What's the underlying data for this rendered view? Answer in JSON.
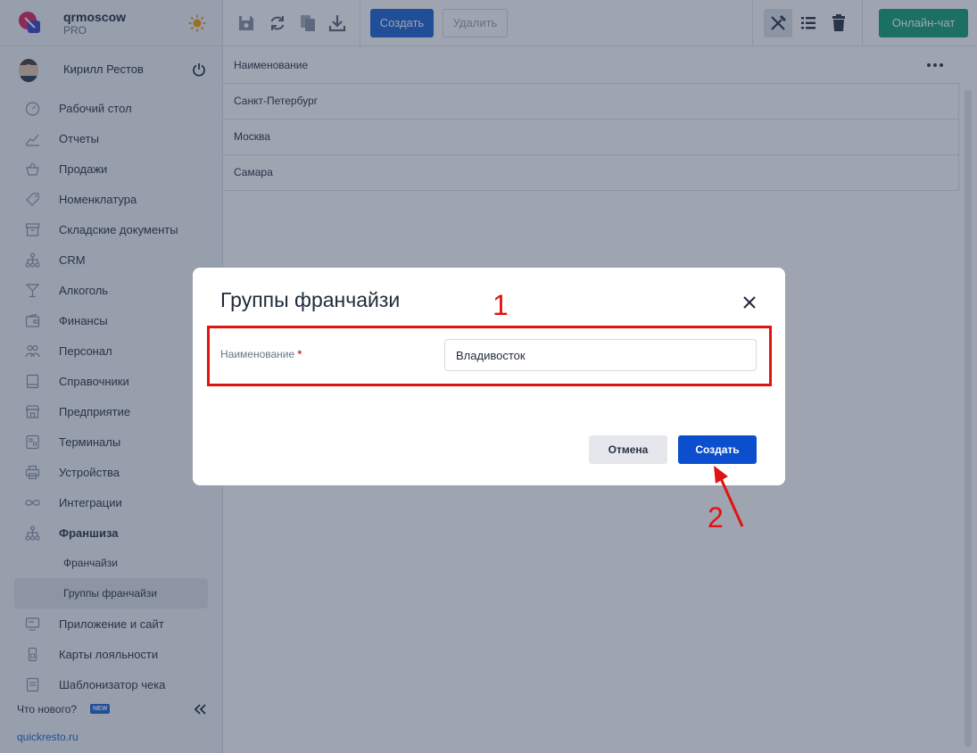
{
  "brand": {
    "org": "qrmoscow",
    "plan": "PRO"
  },
  "user": {
    "name": "Кирилл Рестов"
  },
  "sidebar": {
    "items": [
      {
        "label": "Рабочий стол",
        "icon": "dashboard-icon"
      },
      {
        "label": "Отчеты",
        "icon": "chart-icon"
      },
      {
        "label": "Продажи",
        "icon": "basket-icon"
      },
      {
        "label": "Номенклатура",
        "icon": "tag-icon"
      },
      {
        "label": "Складские документы",
        "icon": "archive-icon"
      },
      {
        "label": "CRM",
        "icon": "hierarchy-icon"
      },
      {
        "label": "Алкоголь",
        "icon": "glass-icon"
      },
      {
        "label": "Финансы",
        "icon": "wallet-icon"
      },
      {
        "label": "Персонал",
        "icon": "people-icon"
      },
      {
        "label": "Справочники",
        "icon": "book-icon"
      },
      {
        "label": "Предприятие",
        "icon": "store-icon"
      },
      {
        "label": "Терминалы",
        "icon": "qr-icon"
      },
      {
        "label": "Устройства",
        "icon": "printer-icon"
      },
      {
        "label": "Интеграции",
        "icon": "infinity-icon"
      },
      {
        "label": "Франшиза",
        "icon": "hierarchy-icon"
      },
      {
        "label": "Франчайзи"
      },
      {
        "label": "Группы франчайзи"
      },
      {
        "label": "Приложение и сайт",
        "icon": "monitor-icon"
      },
      {
        "label": "Карты лояльности",
        "icon": "card-icon"
      },
      {
        "label": "Шаблонизатор чека",
        "icon": "receipt-icon"
      }
    ],
    "whats_new": "Что нового?",
    "new_badge": "NEW",
    "site": "quickresto.ru"
  },
  "toolbar": {
    "create_label": "Создать",
    "delete_label": "Удалить",
    "chat_label": "Онлайн-чат"
  },
  "grid": {
    "header": "Наименование",
    "rows": [
      "Санкт-Петербург",
      "Москва",
      "Самара"
    ]
  },
  "modal": {
    "title": "Группы франчайзи",
    "field_label": "Наименование",
    "required_mark": "*",
    "field_value": "Владивосток",
    "cancel_label": "Отмена",
    "create_label": "Создать"
  },
  "annotations": {
    "step1": "1",
    "step2": "2"
  },
  "colors": {
    "accent": "#0b4fcf",
    "chat": "#12a173",
    "annotation": "#e21212"
  }
}
